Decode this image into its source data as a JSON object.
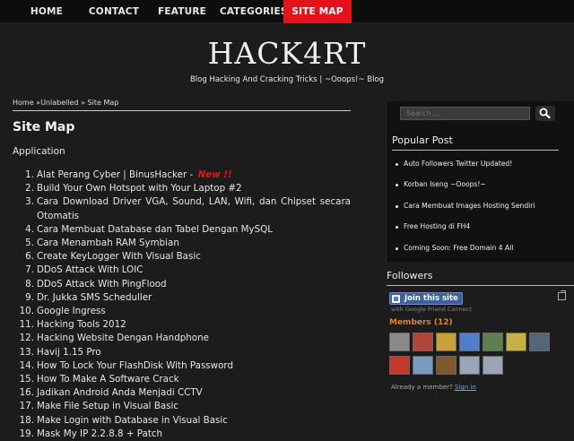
{
  "nav": {
    "items": [
      {
        "label": "HOME",
        "active": false
      },
      {
        "label": "CONTACT",
        "active": false
      },
      {
        "label": "FEATURE",
        "active": false
      },
      {
        "label": "CATEGORIES",
        "active": false
      },
      {
        "label": "SITE MAP",
        "active": true
      }
    ],
    "active_color": "#e5111b"
  },
  "header": {
    "title": "HACK4RT",
    "description": "Blog Hacking And Cracking Tricks | ~Ooops!~ Blog"
  },
  "breadcrumb": {
    "home": "Home",
    "sep1": " »",
    "label": "Unlabelled",
    "sep2": " » ",
    "current": "Site Map"
  },
  "main": {
    "page_title": "Site Map",
    "label_title": "Application",
    "posts": [
      {
        "num": "1.",
        "title": "Alat Perang Cyber | BinusHacker - ",
        "badge": "New !!"
      },
      {
        "num": "2.",
        "title": "Build Your Own Hotspot with Your Laptop #2"
      },
      {
        "num": "3.",
        "title": "Cara Download Driver VGA, Sound, LAN, Wifi, dan Chipset secara Otomatis"
      },
      {
        "num": "4.",
        "title": "Cara Membuat Database dan Tabel Dengan MySQL"
      },
      {
        "num": "5.",
        "title": "Cara Menambah RAM Symbian"
      },
      {
        "num": "6.",
        "title": "Create KeyLogger With Visual Basic"
      },
      {
        "num": "7.",
        "title": "DDoS Attack With LOIC"
      },
      {
        "num": "8.",
        "title": "DDoS Attack With PingFlood"
      },
      {
        "num": "9.",
        "title": "Dr. Jukka SMS Scheduller"
      },
      {
        "num": "10.",
        "title": "Google Ingress"
      },
      {
        "num": "11.",
        "title": "Hacking Tools 2012"
      },
      {
        "num": "12.",
        "title": "Hacking Website Dengan Handphone"
      },
      {
        "num": "13.",
        "title": "Havij 1.15 Pro"
      },
      {
        "num": "14.",
        "title": "How To Lock Your FlashDisk With Password"
      },
      {
        "num": "15.",
        "title": "How To Make A Software Crack"
      },
      {
        "num": "16.",
        "title": "Jadikan Android Anda Menjadi CCTV"
      },
      {
        "num": "17.",
        "title": "Make File Setup in Visual Basic"
      },
      {
        "num": "18.",
        "title": "Make Login with Database in Visual Basic"
      },
      {
        "num": "19.",
        "title": "Mask My IP 2.2.8.8 + Patch"
      }
    ]
  },
  "sidebar": {
    "search_placeholder": "Search ...",
    "popular_title": "Popular Post",
    "popular": [
      "Auto Followers Twitter Updated!",
      "Korban Iseng ~Ooops!~",
      "Cara Membuat Images Hosting Sendiri",
      "Free Hosting di FH4",
      "Coming Soon: Free Domain 4 All"
    ],
    "followers_title": "Followers",
    "join_label": "Join this site",
    "gfc_note": "with Google Friend Connect",
    "members_label": "Members (12)",
    "already_text": "Already a member? ",
    "signin_label": "Sign in",
    "avatar_colors": [
      "#8a8a8a",
      "#b0463a",
      "#c9a03a",
      "#7c5a2c",
      "#4f7fc8",
      "#5f7d4f",
      "#c7b045",
      "#556677",
      "#c43a2a",
      "#7a9ac0",
      "#9aa6b8",
      "#9aa6b8"
    ]
  }
}
